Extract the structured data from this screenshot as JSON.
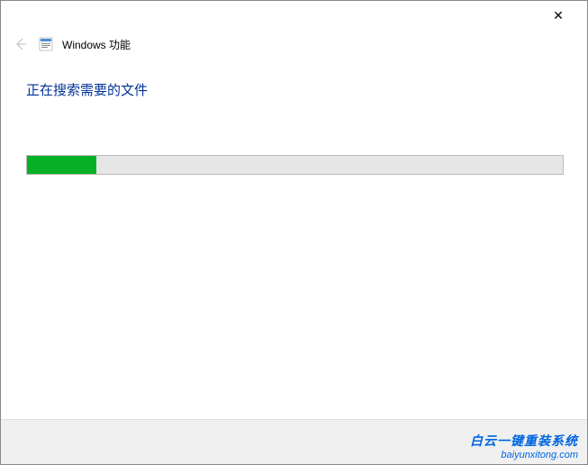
{
  "titlebar": {
    "close_symbol": "✕"
  },
  "header": {
    "title": "Windows 功能"
  },
  "content": {
    "status_text": "正在搜索需要的文件",
    "progress_percent": 13
  },
  "watermark": {
    "line1": "白云一键重装系统",
    "line2": "baiyunxitong.com"
  }
}
